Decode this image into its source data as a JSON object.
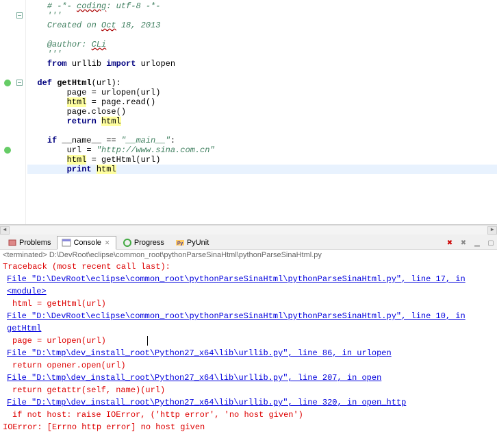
{
  "code": {
    "lines": [
      {
        "indent": 4,
        "parts": [
          {
            "cls": "c-comment",
            "t": "# -*- "
          },
          {
            "cls": "c-comment c-wavy",
            "t": "coding"
          },
          {
            "cls": "c-comment",
            "t": ": utf-8 -*-"
          }
        ]
      },
      {
        "indent": 4,
        "parts": [
          {
            "cls": "c-doc",
            "t": "'''"
          }
        ],
        "fold": true
      },
      {
        "indent": 4,
        "parts": [
          {
            "cls": "c-doc",
            "t": "Created on "
          },
          {
            "cls": "c-doc c-wavy",
            "t": "Oct"
          },
          {
            "cls": "c-doc",
            "t": " 18, 2013"
          }
        ]
      },
      {
        "indent": 4,
        "parts": []
      },
      {
        "indent": 4,
        "parts": [
          {
            "cls": "c-doc",
            "t": "@author: "
          },
          {
            "cls": "c-doc c-wavy",
            "t": "CLi"
          }
        ]
      },
      {
        "indent": 4,
        "parts": [
          {
            "cls": "c-doc",
            "t": "'''"
          }
        ]
      },
      {
        "indent": 4,
        "parts": [
          {
            "cls": "c-keyword",
            "t": "from"
          },
          {
            "cls": "c-normal",
            "t": " urllib "
          },
          {
            "cls": "c-keyword",
            "t": "import"
          },
          {
            "cls": "c-normal",
            "t": " urlopen"
          }
        ]
      },
      {
        "indent": 4,
        "parts": []
      },
      {
        "indent": 2,
        "parts": [
          {
            "cls": "c-keyword",
            "t": "def "
          },
          {
            "cls": "c-funcname",
            "t": "getHtml"
          },
          {
            "cls": "c-normal",
            "t": "(url):"
          }
        ],
        "fold": true,
        "exec": true
      },
      {
        "indent": 8,
        "parts": [
          {
            "cls": "c-normal",
            "t": "page = urlopen(url)"
          }
        ]
      },
      {
        "indent": 8,
        "parts": [
          {
            "cls": "c-normal c-hl",
            "t": "html"
          },
          {
            "cls": "c-normal",
            "t": " = page.read()"
          }
        ]
      },
      {
        "indent": 8,
        "parts": [
          {
            "cls": "c-normal",
            "t": "page.close()"
          }
        ]
      },
      {
        "indent": 8,
        "parts": [
          {
            "cls": "c-keyword",
            "t": "return"
          },
          {
            "cls": "c-normal",
            "t": " "
          },
          {
            "cls": "c-normal c-hl",
            "t": "html"
          }
        ]
      },
      {
        "indent": 4,
        "parts": []
      },
      {
        "indent": 4,
        "parts": [
          {
            "cls": "c-keyword",
            "t": "if"
          },
          {
            "cls": "c-normal",
            "t": " __name__ == "
          },
          {
            "cls": "c-string",
            "t": "\"__main__\""
          },
          {
            "cls": "c-normal",
            "t": ":"
          }
        ]
      },
      {
        "indent": 8,
        "parts": [
          {
            "cls": "c-normal",
            "t": "url = "
          },
          {
            "cls": "c-string",
            "t": "\"http://www.sina.com.cn\""
          }
        ],
        "exec": true
      },
      {
        "indent": 8,
        "parts": [
          {
            "cls": "c-normal c-hl",
            "t": "html"
          },
          {
            "cls": "c-normal",
            "t": " = getHtml(url)"
          }
        ]
      },
      {
        "indent": 8,
        "parts": [
          {
            "cls": "c-keyword",
            "t": "print"
          },
          {
            "cls": "c-normal",
            "t": " "
          },
          {
            "cls": "c-normal c-hl",
            "t": "html"
          }
        ],
        "cursor": true
      }
    ]
  },
  "tabs": {
    "items": [
      {
        "label": "Problems",
        "icon": "problems"
      },
      {
        "label": "Console",
        "icon": "console",
        "active": true,
        "closable": true
      },
      {
        "label": "Progress",
        "icon": "progress"
      },
      {
        "label": "PyUnit",
        "icon": "pyunit"
      }
    ]
  },
  "terminated": "<terminated> D:\\DevRoot\\eclipse\\common_root\\pythonParseSinaHtml\\pythonParseSinaHtml.py",
  "trace": {
    "header": "Traceback (most recent call last):",
    "frames": [
      {
        "file": "File \"D:\\DevRoot\\eclipse\\common_root\\pythonParseSinaHtml\\pythonParseSinaHtml.py\", line 17, in <module>",
        "code": "html = getHtml(url)"
      },
      {
        "file": "File \"D:\\DevRoot\\eclipse\\common_root\\pythonParseSinaHtml\\pythonParseSinaHtml.py\", line 10, in getHtml",
        "code": "page = urlopen(url)",
        "caret": true
      },
      {
        "file": "File \"D:\\tmp\\dev_install_root\\Python27_x64\\lib\\urllib.py\", line 86, in urlopen",
        "code": "return opener.open(url)"
      },
      {
        "file": "File \"D:\\tmp\\dev_install_root\\Python27_x64\\lib\\urllib.py\", line 207, in open",
        "code": "return getattr(self, name)(url)"
      },
      {
        "file": "File \"D:\\tmp\\dev_install_root\\Python27_x64\\lib\\urllib.py\", line 320, in open_http",
        "code": "if not host: raise IOError, ('http error', 'no host given')"
      }
    ],
    "error": "IOError: [Errno http error] no host given"
  }
}
